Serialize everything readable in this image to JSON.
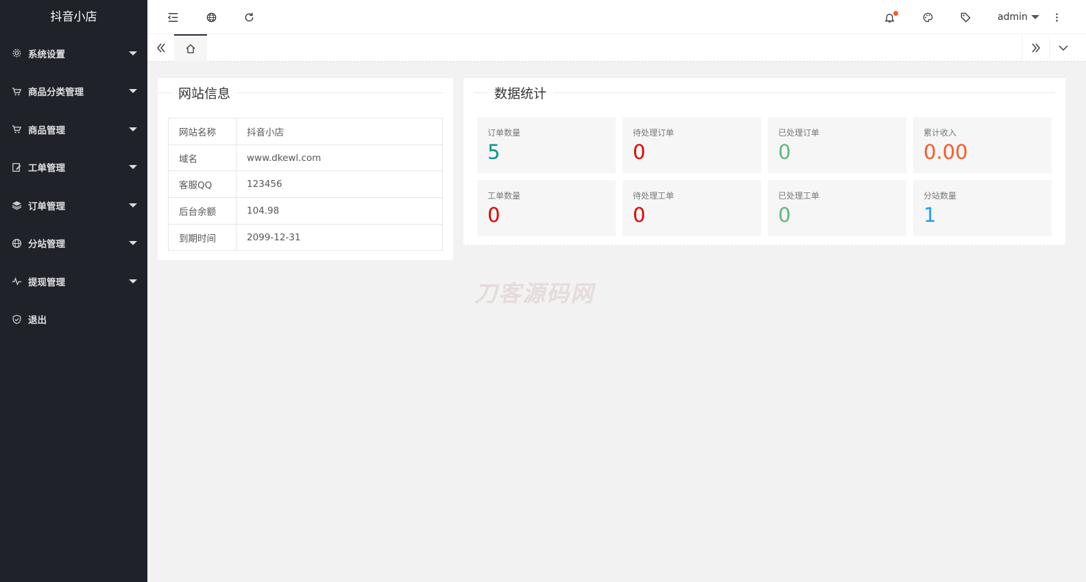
{
  "app": {
    "title": "抖音小店"
  },
  "sidebar": {
    "items": [
      {
        "label": "系统设置",
        "icon": "gear-icon"
      },
      {
        "label": "商品分类管理",
        "icon": "cart-icon"
      },
      {
        "label": "商品管理",
        "icon": "cart-icon"
      },
      {
        "label": "工单管理",
        "icon": "edit-doc-icon"
      },
      {
        "label": "订单管理",
        "icon": "layers-icon"
      },
      {
        "label": "分站管理",
        "icon": "globe-icon"
      },
      {
        "label": "提现管理",
        "icon": "pulse-icon"
      },
      {
        "label": "退出",
        "icon": "shield-check-icon"
      }
    ]
  },
  "header": {
    "username": "admin"
  },
  "site_info": {
    "title": "网站信息",
    "rows": [
      {
        "key": "网站名称",
        "value": "抖音小店"
      },
      {
        "key": "域名",
        "value": "www.dkewl.com"
      },
      {
        "key": "客服QQ",
        "value": "123456"
      },
      {
        "key": "后台余额",
        "value": "104.98"
      },
      {
        "key": "到期时间",
        "value": "2099-12-31"
      }
    ]
  },
  "stats": {
    "title": "数据统计",
    "items": [
      {
        "label": "订单数量",
        "value": "5",
        "color": "#009688"
      },
      {
        "label": "待处理订单",
        "value": "0",
        "color": "#e60000"
      },
      {
        "label": "已处理订单",
        "value": "0",
        "color": "#5fb878"
      },
      {
        "label": "累计收入",
        "value": "0.00",
        "color": "#ff5722"
      },
      {
        "label": "工单数量",
        "value": "0",
        "color": "#e60000"
      },
      {
        "label": "待处理工单",
        "value": "0",
        "color": "#e60000"
      },
      {
        "label": "已处理工单",
        "value": "0",
        "color": "#5fb878"
      },
      {
        "label": "分站数量",
        "value": "1",
        "color": "#1e9fff"
      }
    ]
  },
  "watermark": "刀客源码网"
}
